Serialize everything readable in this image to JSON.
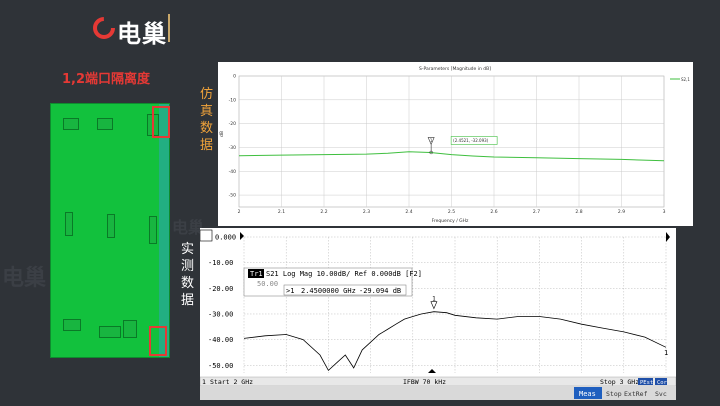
{
  "logo": {
    "text": "电巢"
  },
  "watermark": {
    "text": "电巢"
  },
  "left": {
    "title": "1,2端口隔离度",
    "sim_label": "仿真数据",
    "meas_label": "实测数据"
  },
  "colors": {
    "accent": "#e53935",
    "sim_trace": "#3fbf3f",
    "board": "#12c13d",
    "background": "#2f3338"
  },
  "sim": {
    "title": "S-Parameters [Magnitude in dB]",
    "legend": "S2,1",
    "xlabel": "Frequency / GHz",
    "ylabel": "dB",
    "marker_label": "1",
    "marker_readout": "(2.4521, -32.093)",
    "xticks": [
      "2",
      "2.1",
      "2.2",
      "2.3",
      "2.4",
      "2.5",
      "2.6",
      "2.7",
      "2.8",
      "2.9",
      "3"
    ],
    "yticks": [
      "0",
      "-10",
      "-20",
      "-30",
      "-40",
      "-50"
    ]
  },
  "vna": {
    "top_ref": "0.000",
    "trace_header": "Tr1",
    "trace_info": "S21 Log Mag 10.00dB/ Ref 0.000dB [F2]",
    "marker_line_prefix": ">1",
    "marker_freq": "2.4500000 GHz",
    "marker_val": "-29.094 dB",
    "marker_label": "1",
    "yticks": [
      "0.000",
      "-10.00",
      "-20.00",
      "-30.00",
      "-40.00",
      "-50.00"
    ],
    "ytick_in_box": "50.00",
    "end_label": "1",
    "start": "Start 2 GHz",
    "ifbw": "IFBW 70 kHz",
    "stop": "Stop 3 GHz",
    "row_num": "1",
    "status_items": [
      "Meas",
      "Stop",
      "ExtRef",
      "Svc"
    ],
    "badge1": "PEst",
    "badge2": "Cor"
  },
  "chart_data": [
    {
      "type": "line",
      "title": "S-Parameters [Magnitude in dB]",
      "xlabel": "Frequency / GHz",
      "ylabel": "dB",
      "xlim": [
        2,
        3
      ],
      "ylim": [
        -55,
        0
      ],
      "grid": true,
      "legend": "top-right",
      "series": [
        {
          "name": "S2,1",
          "x": [
            2.0,
            2.1,
            2.2,
            2.3,
            2.35,
            2.4,
            2.45,
            2.5,
            2.55,
            2.6,
            2.7,
            2.8,
            2.9,
            3.0
          ],
          "values": [
            -33.5,
            -33.2,
            -33.0,
            -32.8,
            -32.4,
            -31.8,
            -32.1,
            -33.0,
            -33.6,
            -34.0,
            -34.3,
            -34.7,
            -35.0,
            -35.6
          ]
        }
      ]
    },
    {
      "type": "line",
      "title": "",
      "xlabel": "",
      "ylabel": "",
      "xlim": [
        2,
        3
      ],
      "ylim": [
        -53,
        0
      ],
      "grid": true,
      "series": [
        {
          "name": "S21",
          "x": [
            2.0,
            2.05,
            2.1,
            2.14,
            2.18,
            2.2,
            2.22,
            2.24,
            2.26,
            2.28,
            2.3,
            2.32,
            2.34,
            2.36,
            2.38,
            2.4,
            2.42,
            2.45,
            2.48,
            2.5,
            2.55,
            2.6,
            2.65,
            2.7,
            2.75,
            2.8,
            2.85,
            2.9,
            2.95,
            3.0
          ],
          "values": [
            -39.5,
            -38.5,
            -38.0,
            -40.0,
            -46.0,
            -52.0,
            -49.0,
            -46.0,
            -51.0,
            -44.0,
            -41.0,
            -38.0,
            -36.0,
            -34.0,
            -32.0,
            -31.0,
            -30.0,
            -29.1,
            -29.5,
            -30.5,
            -31.5,
            -32.0,
            -31.0,
            -31.0,
            -32.0,
            -34.0,
            -35.5,
            -37.0,
            -39.0,
            -43.0
          ]
        }
      ]
    }
  ]
}
